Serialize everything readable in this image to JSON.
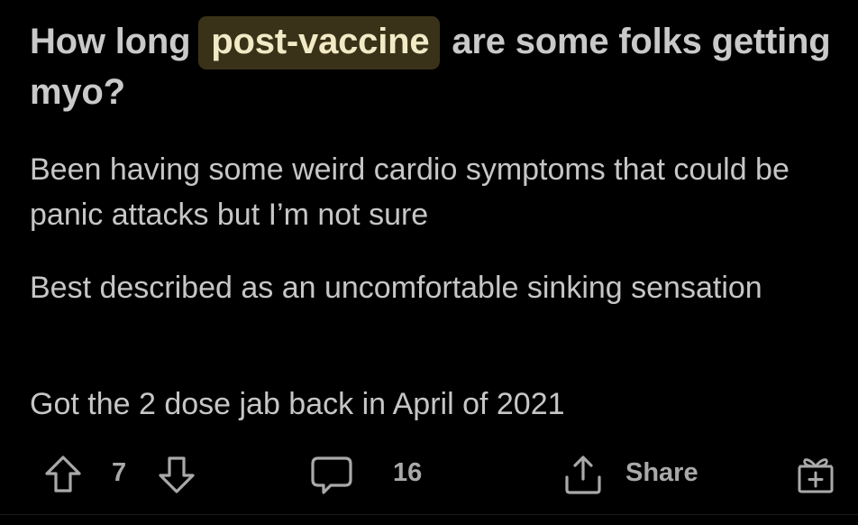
{
  "post": {
    "title_before": "How long ",
    "title_highlight": "post-vaccine",
    "title_after": " are some folks getting myo?",
    "paragraphs": [
      "Been having some weird cardio symptoms that could be panic attacks but I’m not sure",
      "Best described as an uncomfortable sinking sensation",
      "Got the 2 dose jab back in April of 2021"
    ],
    "highlight_color": "#3a3218"
  },
  "actions": {
    "upvote_icon": "arrow-up-icon",
    "score": "7",
    "downvote_icon": "arrow-down-icon",
    "comment_icon": "comment-bubble-icon",
    "comment_count": "16",
    "share_icon": "share-icon",
    "share_label": "Share",
    "award_icon": "gift-box-icon"
  }
}
